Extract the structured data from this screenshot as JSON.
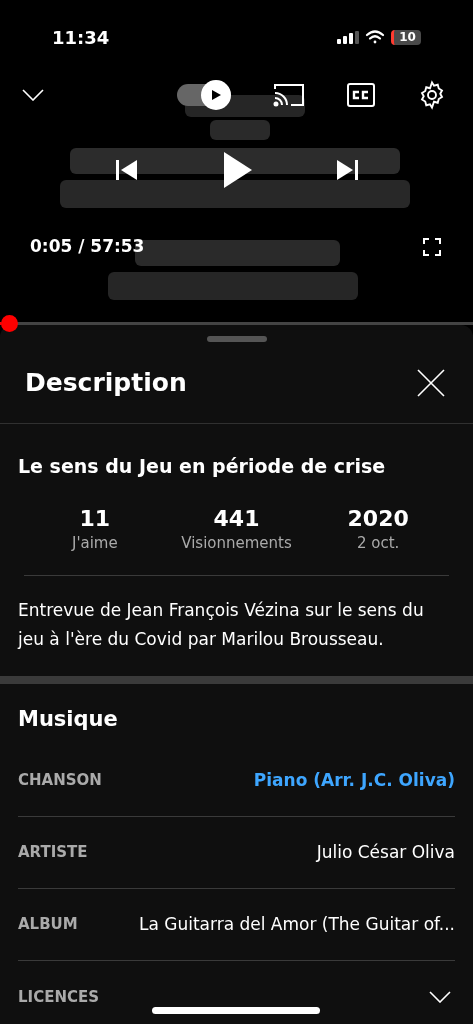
{
  "status_bar": {
    "time": "11:34",
    "battery": "10"
  },
  "player": {
    "autoplay": {
      "on": true
    },
    "time": "0:05 / 57:53",
    "progress": {
      "level": 0.0014
    }
  },
  "sheet": {
    "title": "Description"
  },
  "video": {
    "title": "Le sens du Jeu en période de crise",
    "stats": [
      {
        "value": "11",
        "label": "J'aime"
      },
      {
        "value": "441",
        "label": "Visionnements"
      },
      {
        "value": "2020",
        "label": "2 oct."
      }
    ],
    "description": "Entrevue de Jean François Vézina sur le sens du jeu à l'ère du Covid par Marilou Brousseau."
  },
  "music": {
    "title": "Musique",
    "rows": [
      {
        "kind": "link",
        "label": "CHANSON",
        "value": "Piano (Arr. J.C. Oliva)"
      },
      {
        "kind": "text",
        "label": "ARTISTE",
        "value": "Julio César Oliva"
      },
      {
        "kind": "text",
        "label": "ALBUM",
        "value": "La Guitarra del Amor (The Guitar of..."
      },
      {
        "kind": "expandable",
        "label": "LICENCES",
        "expanded": false
      }
    ]
  }
}
